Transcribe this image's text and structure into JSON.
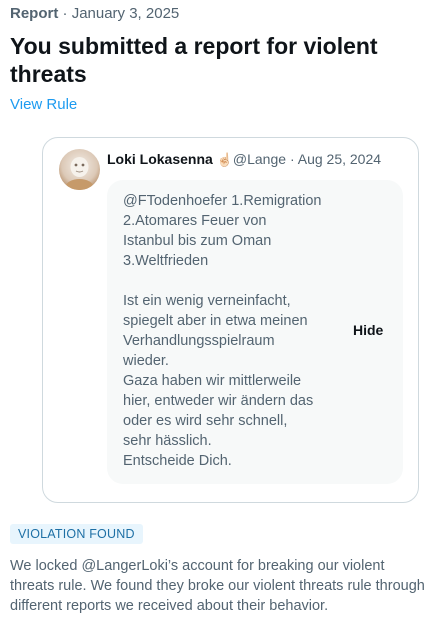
{
  "header": {
    "type_label": "Report",
    "separator": "·",
    "date": "January 3, 2025",
    "title": "You submitted a report for violent threats",
    "view_rule_label": "View Rule"
  },
  "reported_post": {
    "author_name": "Loki Lokasenna",
    "author_emoji": "☝🏻",
    "handle": "@Lange",
    "date": "Aug 25, 2024",
    "lines": [
      "@FTodenhoefer 1.Remigration",
      "2.Atomares Feuer von",
      "Istanbul bis zum Oman",
      "3.Weltfrieden",
      "",
      "Ist ein wenig verneinfacht,",
      "spiegelt aber in etwa meinen",
      "Verhandlungsspielraum",
      "wieder.",
      "Gaza haben wir mittlerweile",
      "hier, entweder wir ändern das",
      "oder es wird sehr schnell,",
      "sehr hässlich.",
      "Entscheide Dich."
    ],
    "hide_label": "Hide",
    "avatar_icon": "avatar-photo-icon"
  },
  "verdict": {
    "badge": "VIOLATION FOUND",
    "summary": "We locked @LangerLoki’s account for breaking our violent threats rule. We found they broke our violent threats rule through different reports we received about their behavior."
  },
  "colors": {
    "text": "#0f1419",
    "secondary": "#536471",
    "link": "#1d9bf0",
    "badge_bg": "#e8f5fd",
    "border": "#cfd9de",
    "bubble_bg": "#f7f9f9"
  }
}
